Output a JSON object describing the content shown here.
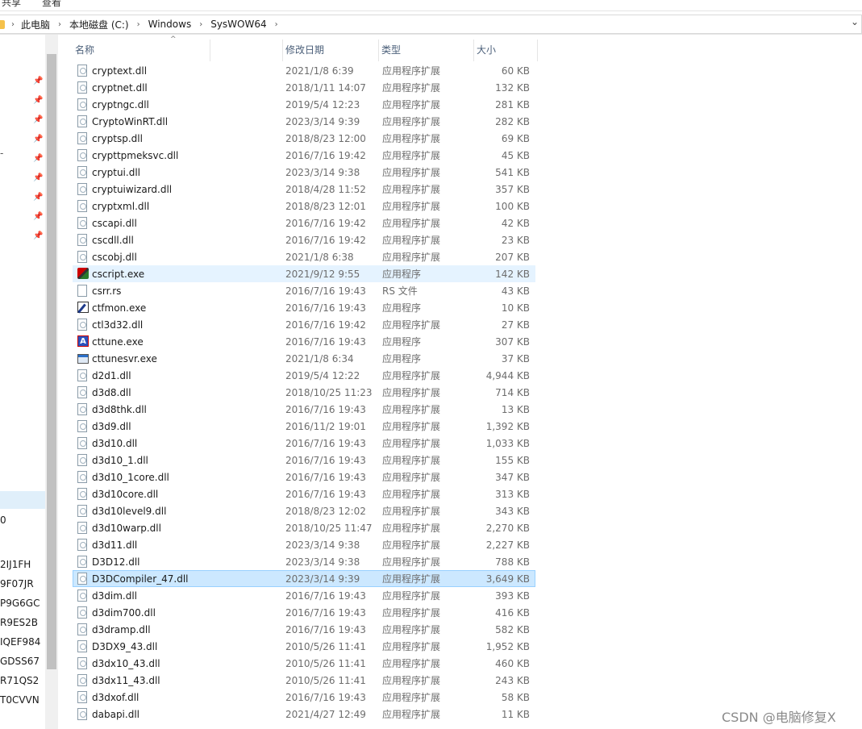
{
  "ribbon": {
    "share": "共享",
    "view": "查看"
  },
  "breadcrumb": [
    "此电脑",
    "本地磁盘 (C:)",
    "Windows",
    "SysWOW64"
  ],
  "nav": {
    "items": [
      "2IJ1FH",
      "9F07JR",
      "P9G6GC",
      "R9ES2B",
      "IQEF984",
      "GDSS67",
      "R71QS2",
      "T0CVVN"
    ],
    "partial_items": [
      "-",
      "0"
    ]
  },
  "columns": {
    "name": "名称",
    "date": "修改日期",
    "type": "类型",
    "size": "大小"
  },
  "files": [
    {
      "name": "cryptext.dll",
      "date": "2021/1/8 6:39",
      "type": "应用程序扩展",
      "size": "60 KB",
      "icon": "dll-icon"
    },
    {
      "name": "cryptnet.dll",
      "date": "2018/1/11 14:07",
      "type": "应用程序扩展",
      "size": "132 KB",
      "icon": "dll-icon"
    },
    {
      "name": "cryptngc.dll",
      "date": "2019/5/4 12:23",
      "type": "应用程序扩展",
      "size": "281 KB",
      "icon": "dll-icon"
    },
    {
      "name": "CryptoWinRT.dll",
      "date": "2023/3/14 9:39",
      "type": "应用程序扩展",
      "size": "282 KB",
      "icon": "dll-icon"
    },
    {
      "name": "cryptsp.dll",
      "date": "2018/8/23 12:00",
      "type": "应用程序扩展",
      "size": "69 KB",
      "icon": "dll-icon"
    },
    {
      "name": "crypttpmeksvc.dll",
      "date": "2016/7/16 19:42",
      "type": "应用程序扩展",
      "size": "45 KB",
      "icon": "dll-icon"
    },
    {
      "name": "cryptui.dll",
      "date": "2023/3/14 9:38",
      "type": "应用程序扩展",
      "size": "541 KB",
      "icon": "dll-icon"
    },
    {
      "name": "cryptuiwizard.dll",
      "date": "2018/4/28 11:52",
      "type": "应用程序扩展",
      "size": "357 KB",
      "icon": "dll-icon"
    },
    {
      "name": "cryptxml.dll",
      "date": "2018/8/23 12:01",
      "type": "应用程序扩展",
      "size": "100 KB",
      "icon": "dll-icon"
    },
    {
      "name": "cscapi.dll",
      "date": "2016/7/16 19:42",
      "type": "应用程序扩展",
      "size": "42 KB",
      "icon": "dll-icon"
    },
    {
      "name": "cscdll.dll",
      "date": "2016/7/16 19:42",
      "type": "应用程序扩展",
      "size": "23 KB",
      "icon": "dll-icon"
    },
    {
      "name": "cscobj.dll",
      "date": "2021/1/8 6:38",
      "type": "应用程序扩展",
      "size": "207 KB",
      "icon": "dll-icon"
    },
    {
      "name": "cscript.exe",
      "date": "2021/9/12 9:55",
      "type": "应用程序",
      "size": "142 KB",
      "icon": "script-icon",
      "state": "hover"
    },
    {
      "name": "csrr.rs",
      "date": "2016/7/16 19:43",
      "type": "RS 文件",
      "size": "43 KB",
      "icon": "file-icon"
    },
    {
      "name": "ctfmon.exe",
      "date": "2016/7/16 19:43",
      "type": "应用程序",
      "size": "10 KB",
      "icon": "pen-icon"
    },
    {
      "name": "ctl3d32.dll",
      "date": "2016/7/16 19:42",
      "type": "应用程序扩展",
      "size": "27 KB",
      "icon": "dll-icon"
    },
    {
      "name": "cttune.exe",
      "date": "2016/7/16 19:43",
      "type": "应用程序",
      "size": "307 KB",
      "icon": "font-icon"
    },
    {
      "name": "cttunesvr.exe",
      "date": "2021/1/8 6:34",
      "type": "应用程序",
      "size": "37 KB",
      "icon": "window-icon"
    },
    {
      "name": "d2d1.dll",
      "date": "2019/5/4 12:22",
      "type": "应用程序扩展",
      "size": "4,944 KB",
      "icon": "dll-icon"
    },
    {
      "name": "d3d8.dll",
      "date": "2018/10/25 11:23",
      "type": "应用程序扩展",
      "size": "714 KB",
      "icon": "dll-icon"
    },
    {
      "name": "d3d8thk.dll",
      "date": "2016/7/16 19:43",
      "type": "应用程序扩展",
      "size": "13 KB",
      "icon": "dll-icon"
    },
    {
      "name": "d3d9.dll",
      "date": "2016/11/2 19:01",
      "type": "应用程序扩展",
      "size": "1,392 KB",
      "icon": "dll-icon"
    },
    {
      "name": "d3d10.dll",
      "date": "2016/7/16 19:43",
      "type": "应用程序扩展",
      "size": "1,033 KB",
      "icon": "dll-icon"
    },
    {
      "name": "d3d10_1.dll",
      "date": "2016/7/16 19:43",
      "type": "应用程序扩展",
      "size": "155 KB",
      "icon": "dll-icon"
    },
    {
      "name": "d3d10_1core.dll",
      "date": "2016/7/16 19:43",
      "type": "应用程序扩展",
      "size": "347 KB",
      "icon": "dll-icon"
    },
    {
      "name": "d3d10core.dll",
      "date": "2016/7/16 19:43",
      "type": "应用程序扩展",
      "size": "313 KB",
      "icon": "dll-icon"
    },
    {
      "name": "d3d10level9.dll",
      "date": "2018/8/23 12:02",
      "type": "应用程序扩展",
      "size": "343 KB",
      "icon": "dll-icon"
    },
    {
      "name": "d3d10warp.dll",
      "date": "2018/10/25 11:47",
      "type": "应用程序扩展",
      "size": "2,270 KB",
      "icon": "dll-icon"
    },
    {
      "name": "d3d11.dll",
      "date": "2023/3/14 9:38",
      "type": "应用程序扩展",
      "size": "2,227 KB",
      "icon": "dll-icon"
    },
    {
      "name": "D3D12.dll",
      "date": "2023/3/14 9:38",
      "type": "应用程序扩展",
      "size": "788 KB",
      "icon": "dll-icon"
    },
    {
      "name": "D3DCompiler_47.dll",
      "date": "2023/3/14 9:39",
      "type": "应用程序扩展",
      "size": "3,649 KB",
      "icon": "dll-icon",
      "state": "selected"
    },
    {
      "name": "d3dim.dll",
      "date": "2016/7/16 19:43",
      "type": "应用程序扩展",
      "size": "393 KB",
      "icon": "dll-icon"
    },
    {
      "name": "d3dim700.dll",
      "date": "2016/7/16 19:43",
      "type": "应用程序扩展",
      "size": "416 KB",
      "icon": "dll-icon"
    },
    {
      "name": "d3dramp.dll",
      "date": "2016/7/16 19:43",
      "type": "应用程序扩展",
      "size": "582 KB",
      "icon": "dll-icon"
    },
    {
      "name": "D3DX9_43.dll",
      "date": "2010/5/26 11:41",
      "type": "应用程序扩展",
      "size": "1,952 KB",
      "icon": "dll-icon"
    },
    {
      "name": "d3dx10_43.dll",
      "date": "2010/5/26 11:41",
      "type": "应用程序扩展",
      "size": "460 KB",
      "icon": "dll-icon"
    },
    {
      "name": "d3dx11_43.dll",
      "date": "2010/5/26 11:41",
      "type": "应用程序扩展",
      "size": "243 KB",
      "icon": "dll-icon"
    },
    {
      "name": "d3dxof.dll",
      "date": "2016/7/16 19:43",
      "type": "应用程序扩展",
      "size": "58 KB",
      "icon": "dll-icon"
    },
    {
      "name": "dabapi.dll",
      "date": "2021/4/27 12:49",
      "type": "应用程序扩展",
      "size": "11 KB",
      "icon": "dll-icon"
    }
  ],
  "watermark": "CSDN @电脑修复X"
}
